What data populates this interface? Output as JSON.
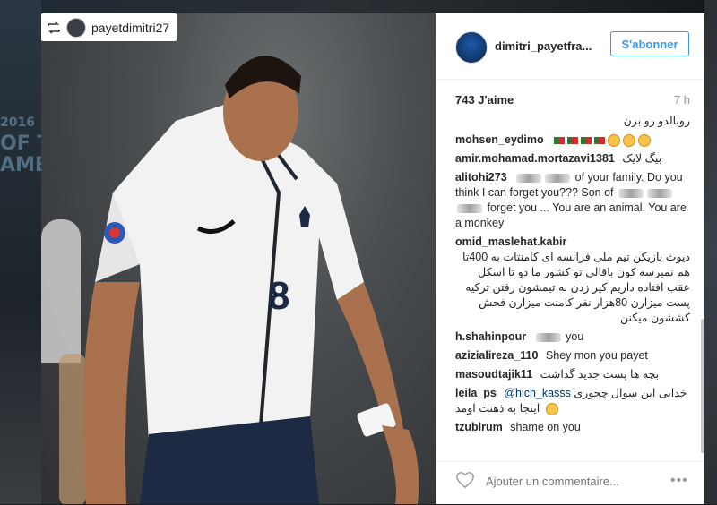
{
  "repost": {
    "username": "payetdimitri27"
  },
  "header": {
    "username": "dimitri_payetfra...",
    "follow_label": "S'abonner"
  },
  "stats": {
    "likes": "743 J'aime",
    "time": "7 h"
  },
  "background_text": {
    "year": "2016",
    "line2": "OF T",
    "line3": "AME"
  },
  "jersey": {
    "number": "8"
  },
  "comments": [
    {
      "text": "روبالدو رو برن"
    },
    {
      "user": "mohsen_eydimo"
    },
    {
      "user": "amir.mohamad.mortazavi1381",
      "text": "بیگ لایک"
    },
    {
      "user": "alitohi273",
      "text_a": "of your family.",
      "text_b": "Do you think I can forget you??? Son of",
      "text_c": "forget you ... You are an",
      "text_d": "animal. You are a monkey"
    },
    {
      "user": "omid_maslehat.kabir",
      "text": "دیوث بازیکن تیم ملی فرانسه ای کامنتات به 400تا هم نمیرسه کون باقالی تو کشور ما دو تا اسکل عقب افتاده داریم کیر زدن به تیمشون رفتن ترکیه پست میزارن 80هزار نفر کامنت میزارن فحش کششون میکنن"
    },
    {
      "user": "h.shahinpour",
      "text": "you"
    },
    {
      "user": "azizialireza_110",
      "text": "Shey mon you payet"
    },
    {
      "user": "masoudtajik11",
      "text": "بچه ها پست جدید گذاشت"
    },
    {
      "user": "leila_ps",
      "mention": "@hich_kasss",
      "text": "خدایی این سوال چجوری اینجا به ذهنت اومد"
    },
    {
      "user": "tzublrum",
      "text": "shame on you"
    }
  ],
  "composer": {
    "placeholder": "Ajouter un commentaire..."
  },
  "colors": {
    "accent": "#3897f0",
    "text": "#262626",
    "muted": "#999999"
  },
  "icons": {
    "repost": "repost-icon",
    "like": "heart-icon",
    "more": "more-options-icon"
  }
}
